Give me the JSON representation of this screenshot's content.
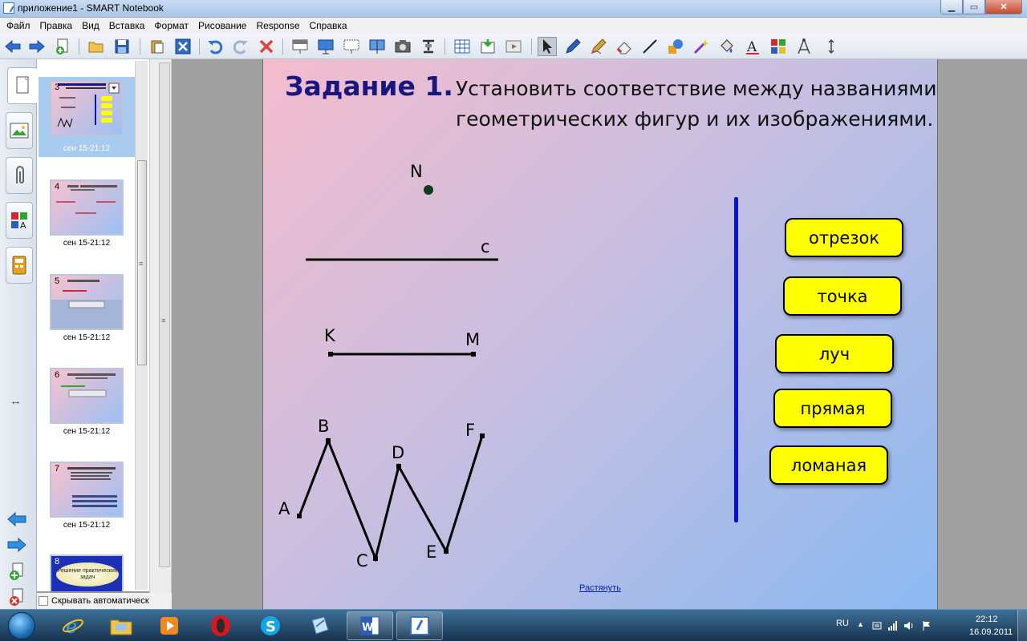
{
  "window": {
    "title": "приложение1 - SMART Notebook",
    "min": "▁",
    "max": "▭",
    "close": "✕"
  },
  "menu": [
    "Файл",
    "Правка",
    "Вид",
    "Вставка",
    "Формат",
    "Рисование",
    "Response",
    "Справка"
  ],
  "sorter": {
    "thumbs": [
      {
        "num": "3",
        "caption": "сен 15-21:12",
        "selected": true
      },
      {
        "num": "4",
        "caption": "сен 15-21:12"
      },
      {
        "num": "5",
        "caption": "сен 15-21:12"
      },
      {
        "num": "6",
        "caption": "сен 15-21:12"
      },
      {
        "num": "7",
        "caption": "сен 15-21:12"
      },
      {
        "num": "8",
        "caption": "",
        "banner": "Решение практических задач"
      }
    ],
    "autohide_label": "Скрывать автоматическ"
  },
  "slide": {
    "title": "Задание 1.",
    "text": "Установить соответствие между названиями геометрических фигур и их изображениями.",
    "labels": {
      "n": "N",
      "c": "c",
      "k": "K",
      "m": "M",
      "a": "A",
      "b": "B",
      "cc": "C",
      "d": "D",
      "e": "E",
      "f": "F"
    },
    "answers": [
      "отрезок",
      "точка",
      "луч",
      "прямая",
      "ломаная"
    ],
    "stretch_link": "Растянуть"
  },
  "taskbar": {
    "lang": "RU",
    "time": "22:12",
    "date": "16.09.2011"
  },
  "colors": {
    "title_blue": "#1a1680",
    "divider_blue": "#0a10d8",
    "answer_yellow": "#ffff00"
  }
}
